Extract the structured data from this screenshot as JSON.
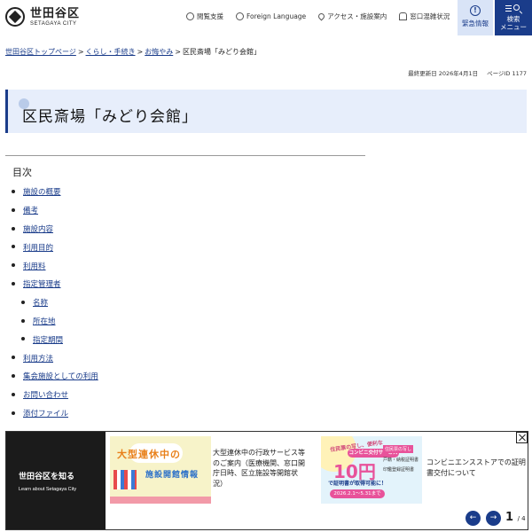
{
  "header": {
    "logo_ja": "世田谷区",
    "logo_en": "SETAGAYA CITY",
    "utils": [
      {
        "label": "閲覧支援",
        "icon": "gear-icon"
      },
      {
        "label": "Foreign Language",
        "icon": "globe-icon"
      },
      {
        "label": "アクセス・施設案内",
        "icon": "map-pin-icon"
      },
      {
        "label": "窓口混雑状況",
        "icon": "people-icon"
      }
    ],
    "emergency_label": "緊急情報",
    "emergency_icon": "!",
    "search_label_1": "検索",
    "search_label_2": "メニュー"
  },
  "breadcrumb": {
    "items": [
      "世田谷区トップページ",
      "くらし・手続き",
      "お悔やみ"
    ],
    "current": "区民斎場「みどり会館」",
    "separator": ">"
  },
  "meta": {
    "updated": "最終更新日 2026年4月1日",
    "page_id": "ページID 1177"
  },
  "page_title": "区民斎場「みどり会館」",
  "toc": {
    "heading": "目次",
    "items": [
      {
        "label": "施設の概要",
        "level": 1
      },
      {
        "label": "備考",
        "level": 1
      },
      {
        "label": "施設内容",
        "level": 1
      },
      {
        "label": "利用目的",
        "level": 1
      },
      {
        "label": "利用料",
        "level": 1
      },
      {
        "label": "指定管理者",
        "level": 1
      },
      {
        "label": "名称",
        "level": 2
      },
      {
        "label": "所在地",
        "level": 2
      },
      {
        "label": "指定期間",
        "level": 2
      },
      {
        "label": "利用方法",
        "level": 1
      },
      {
        "label": "集会施設としての利用",
        "level": 1
      },
      {
        "label": "お問い合わせ",
        "level": 1
      },
      {
        "label": "添付ファイル",
        "level": 1
      }
    ]
  },
  "banner": {
    "label_ja": "世田谷区を知る",
    "label_en": "Learn about Setagaya City",
    "card1": {
      "img_t1": "大型連休中の",
      "img_t2": "施設開館情報",
      "text": "大型連休中の行政サービス等のご案内（医療機関、窓口開庁日時、区立施設等開館状況）"
    },
    "card2": {
      "img_t1": "住民票の写し、便利な",
      "img_pill": "コンビニ交付サービス",
      "img_big": "10円",
      "img_sub": "で証明書が取得可能に！",
      "img_date": "2026.2.1〜5.31まで",
      "img_side": [
        "住民票の写し",
        "戸籍・納税証明書",
        "印鑑登録証明書"
      ],
      "text": "コンビニエンスストアでの証明書交付について"
    },
    "prev_label": "←",
    "next_label": "→",
    "page_current": "1",
    "page_total": "/ 4"
  },
  "colors": {
    "accent": "#1a3c8a",
    "title_bg": "#e7eefb",
    "emergency_bg": "#d9e4f7",
    "banner_label_bg": "#1b1b1b"
  }
}
